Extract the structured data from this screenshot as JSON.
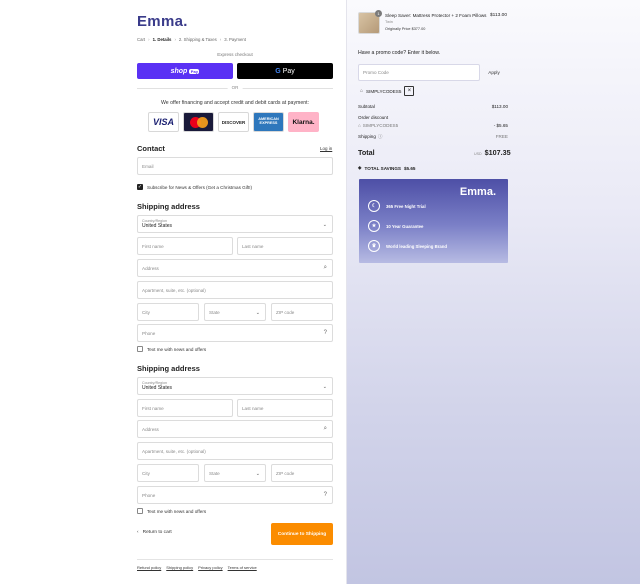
{
  "brand": {
    "logo": "Emma."
  },
  "breadcrumb": [
    {
      "label": "Cart"
    },
    {
      "label": "1. Details",
      "current": true
    },
    {
      "label": "2. Shipping & Taxes"
    },
    {
      "label": "3. Payment"
    }
  ],
  "express": {
    "label": "Express checkout",
    "shop_pay": "shop",
    "shop_pay_pill": "Pay",
    "gpay": "Pay",
    "or": "OR"
  },
  "financing": {
    "text": "We offer financing and accept credit and debit cards at payment:",
    "cards": [
      "VISA",
      "MasterCard",
      "DISCOVER",
      "AMERICAN EXPRESS",
      "Klarna."
    ]
  },
  "contact": {
    "title": "Contact",
    "login": "Log in",
    "email_placeholder": "Email",
    "subscribe_label": "Subscribe for News & Offers (Get a Christmas Gift!)"
  },
  "shipping1": {
    "title": "Shipping address",
    "country_label": "Country/Region",
    "country_value": "United States",
    "first_name": "First name",
    "last_name": "Last name",
    "address": "Address",
    "apartment": "Apartment, suite, etc. (optional)",
    "city": "City",
    "state": "State",
    "zip": "ZIP code",
    "phone": "Phone",
    "text_me": "Text me with news and offers"
  },
  "shipping2": {
    "title": "Shipping address",
    "country_label": "Country/Region",
    "country_value": "United States",
    "first_name": "First name",
    "last_name": "Last name",
    "address": "Address",
    "apartment": "Apartment, suite, etc. (optional)",
    "city": "City",
    "state": "State",
    "zip": "ZIP code",
    "phone": "Phone",
    "text_me": "Text me with news and offers"
  },
  "actions": {
    "return": "Return to cart",
    "continue": "Continue to Shipping"
  },
  "footer": [
    "Refund policy",
    "Shipping policy",
    "Privacy policy",
    "Terms of service"
  ],
  "order": {
    "item": {
      "qty": "1",
      "name": "Sleep Saver: Mattress Protector + 2 Foam Pillows",
      "variant": "Twin",
      "original": "Originally Price $377.00",
      "price": "$113.00"
    },
    "promo_question": "Have a promo code? Enter it below.",
    "promo_placeholder": "Promo Code",
    "apply": "Apply",
    "applied_code": "SIMPLYCODES5",
    "subtotal_label": "Subtotal",
    "subtotal": "$113.00",
    "order_discount_label": "Order discount",
    "discount_code": "SIMPLYCODES5",
    "discount": "- $5.65",
    "shipping_label": "Shipping",
    "shipping": "FREE",
    "total_label": "Total",
    "currency": "USD",
    "total": "$107.35",
    "savings_label": "TOTAL SAVINGS",
    "savings": "$5.65"
  },
  "promo_card": {
    "logo": "Emma.",
    "features": [
      {
        "icon": "moon-365-icon",
        "label": "365 Free Night Trial"
      },
      {
        "icon": "award-icon",
        "label": "10 Year Guarantee"
      },
      {
        "icon": "trophy-icon",
        "label": "World leading Sleeping Brand"
      }
    ]
  }
}
